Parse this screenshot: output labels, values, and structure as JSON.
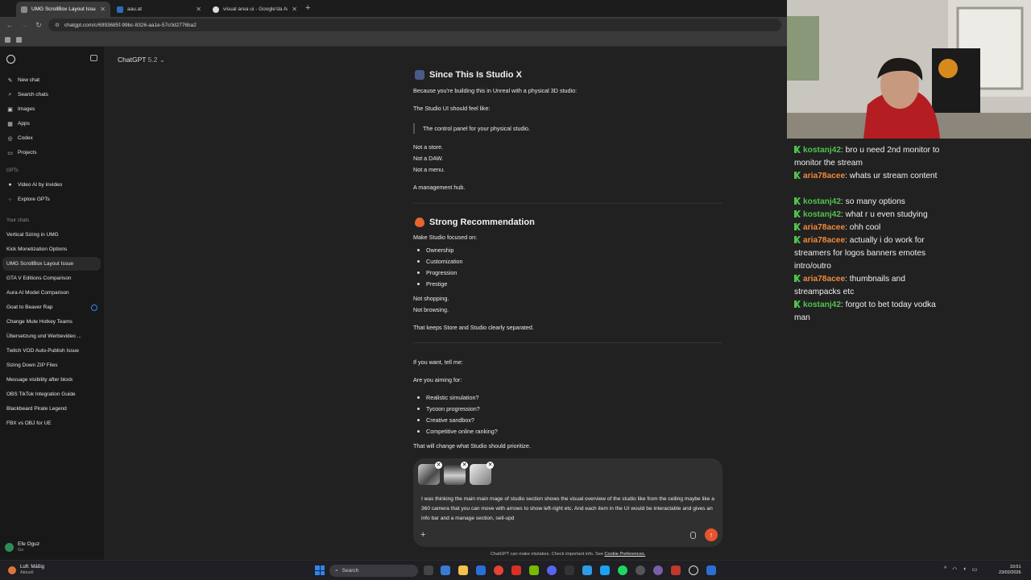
{
  "browser": {
    "tabs": [
      {
        "title": "UMG ScrollBox Layout Issue",
        "active": true
      },
      {
        "title": "aau.at",
        "active": false
      },
      {
        "title": "visual area ui - Google'da Ara",
        "active": false
      }
    ],
    "url": "chatgpt.com/c/6993685f-99bc-8326-aa1e-57c0d2776ba2"
  },
  "sidebar": {
    "nav": [
      "New chat",
      "Search chats",
      "Images",
      "Apps",
      "Codex",
      "Projects"
    ],
    "gpts_header": "GPTs",
    "gpts": [
      "Video AI by invideo",
      "Explore GPTs"
    ],
    "chats_header": "Your chats",
    "chats": [
      "Vertical Sizing in UMG",
      "Kick Monetization Options",
      "UMG ScrollBox Layout Issue",
      "GTA V Editions Comparison",
      "Aura AI Model Comparison",
      "Goat to Beaver Rap",
      "Change Mute Hotkey Teams",
      "Übersetzung und Werbevideo ...",
      "Twitch VOD Auto-Publish Issue",
      "Sizing Down ZIP Files",
      "Message visibility after block",
      "OBS TikTok Integration Guide",
      "Blackbeard Pirate Legend",
      "FBX vs OBJ for UE"
    ],
    "selected_chat": "UMG ScrollBox Layout Issue",
    "user": {
      "name": "Efe Oguz",
      "plan": "Go"
    }
  },
  "header": {
    "model": "ChatGPT",
    "version": "5.2"
  },
  "message": {
    "section1_title": "Since This Is Studio X",
    "p1": "Because you're building this in Unreal with a physical 3D studio:",
    "p2": "The Studio UI should feel like:",
    "quote": "The control panel for your physical studio.",
    "not1": "Not a store.",
    "not2": "Not a DAW.",
    "not3": "Not a menu.",
    "hub": "A management hub.",
    "section2_title": "Strong Recommendation",
    "focus_intro": "Make Studio focused on:",
    "focus": [
      "Ownership",
      "Customization",
      "Progression",
      "Prestige"
    ],
    "not_shopping": "Not shopping.",
    "not_browsing": "Not browsing.",
    "separated": "That keeps Store and Studio clearly separated.",
    "tell_me": "If you want, tell me:",
    "aiming": "Are you aiming for:",
    "options": [
      "Realistic simulation?",
      "Tycoon progression?",
      "Creative sandbox?",
      "Competitive online ranking?"
    ],
    "change": "That will change what Studio should prioritize."
  },
  "composer": {
    "text": "I was thinking the main main mage of studio section shows the visual overview of the studio like from the ceiling maybe like a 360 camera that you can move with arrows to show left-right etc. And each item in the UI would be interactable and gives an info bar and a manage section, sell-upd",
    "attachments": 3
  },
  "disclaimer": {
    "text": "ChatGPT can make mistakes. Check important info. See",
    "link": "Cookie Preferences."
  },
  "stream_chat": [
    {
      "user": "kostanj42",
      "color": "#53c24d",
      "text": "bro u need 2nd monitor to monitor the stream"
    },
    {
      "user": "aria78acee",
      "color": "#f08a3c",
      "text": "whats ur stream content"
    },
    {
      "user": "kostanj42",
      "color": "#53c24d",
      "text": "so many options"
    },
    {
      "user": "kostanj42",
      "color": "#53c24d",
      "text": "what r u even studying"
    },
    {
      "user": "aria78acee",
      "color": "#f08a3c",
      "text": "ohh cool"
    },
    {
      "user": "aria78acee",
      "color": "#f08a3c",
      "text": "actually i do work for streamers for logos banners emotes intro/outro"
    },
    {
      "user": "aria78acee",
      "color": "#f08a3c",
      "text": "thumbnails and streampacks etc"
    },
    {
      "user": "kostanj42",
      "color": "#53c24d",
      "text": "forgot to bet today vodka man"
    }
  ],
  "taskbar": {
    "weather_title": "Luft: Mäßig",
    "weather_sub": "Aktuell",
    "search": "Search",
    "time": "10:51",
    "date": "23/02/2026"
  }
}
